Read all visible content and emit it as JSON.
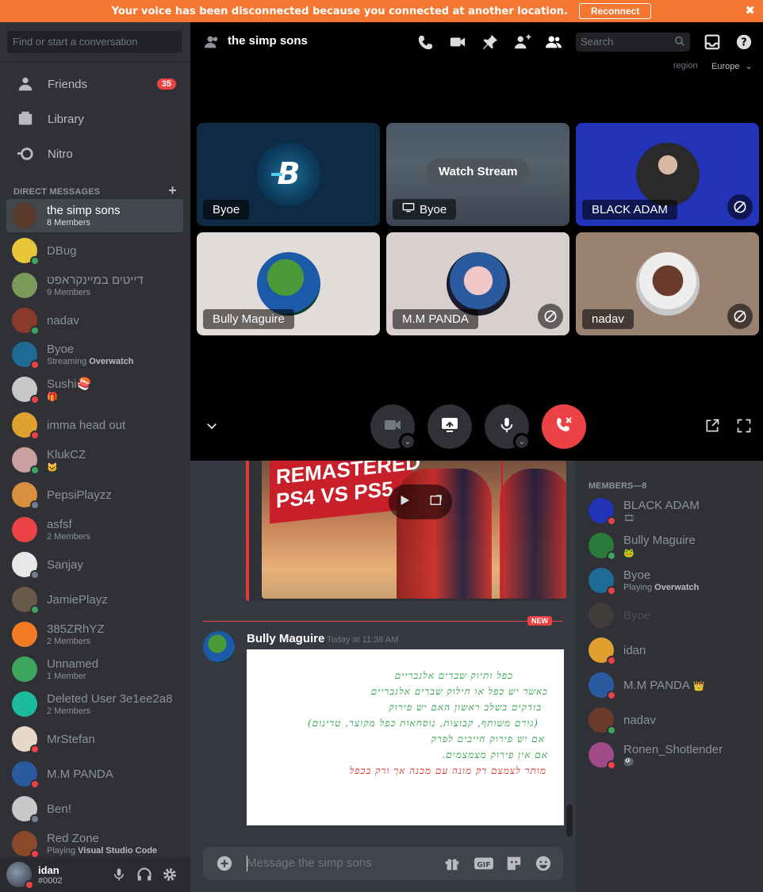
{
  "banner": {
    "message": "Your voice has been disconnected because you connected at another location.",
    "reconnect_label": "Reconnect",
    "close_glyph": "✖",
    "color": "#f57731"
  },
  "sidebar": {
    "search_placeholder": "Find or start a conversation",
    "nav": [
      {
        "label": "Friends",
        "icon": "friends-icon",
        "badge": "35"
      },
      {
        "label": "Library",
        "icon": "library-icon"
      },
      {
        "label": "Nitro",
        "icon": "nitro-icon"
      }
    ],
    "dm_header": "DIRECT MESSAGES",
    "dm_add": "+",
    "dms": [
      {
        "name": "the simp sons",
        "sub": "8 Members",
        "active": true
      },
      {
        "name": "DBug",
        "status": "online"
      },
      {
        "name": "דייטים במיינקראפט",
        "sub": "9 Members"
      },
      {
        "name": "nadav",
        "status": "online"
      },
      {
        "name": "Byoe",
        "sub_pre": "Streaming ",
        "sub_bold": "Overwatch",
        "status": "dnd"
      },
      {
        "name": "Sushi🍣",
        "sub": "🎁",
        "status": "dnd"
      },
      {
        "name": "imma head out",
        "status": "dnd"
      },
      {
        "name": "KlukCZ",
        "sub": "🐱",
        "status": "online"
      },
      {
        "name": "PepsiPlayzz",
        "status": "offline"
      },
      {
        "name": "asfsf",
        "sub": "2 Members"
      },
      {
        "name": "Sanjay",
        "status": "offline"
      },
      {
        "name": "JamiePlayz",
        "status": "online"
      },
      {
        "name": "385ZRhYZ",
        "sub": "2 Members"
      },
      {
        "name": "Unnamed",
        "sub": "1 Member"
      },
      {
        "name": "Deleted User 3e1ee2a8",
        "sub": "2 Members"
      },
      {
        "name": "MrStefan",
        "status": "dnd"
      },
      {
        "name": "M.M PANDA",
        "status": "dnd"
      },
      {
        "name": "Ben!",
        "status": "offline"
      },
      {
        "name": "Red Zone",
        "sub_pre": "Playing ",
        "sub_bold": "Visual Studio Code",
        "status": "dnd"
      }
    ],
    "user": {
      "name": "idan",
      "tag": "#0002"
    }
  },
  "call": {
    "title": "the simp sons",
    "search_placeholder": "Search",
    "region_label": "region",
    "region_value": "Europe",
    "tiles": [
      {
        "name": "Byoe",
        "bg": "#0f2a45"
      },
      {
        "name": "Byoe",
        "bg": "#3a4a5a",
        "stream_label": "Watch Stream"
      },
      {
        "name": "BLACK ADAM",
        "bg": "#2333b8"
      },
      {
        "name": "Bully Maguire",
        "bg": "#e2dcd8"
      },
      {
        "name": "M.M PANDA",
        "bg": "#d8d0ce"
      },
      {
        "name": "nadav",
        "bg": "#9a8272"
      }
    ],
    "end_call_color": "#ed4245"
  },
  "chat": {
    "embed_title": "REMASTERED PS4 VS PS5",
    "new_label": "NEW",
    "author": "Bully Maguire",
    "timestamp": "Today at 11:38 AM",
    "note_lines": [
      {
        "text": "כפל ותיוק שברים אלגבריים",
        "color": "#2fa14a"
      },
      {
        "text": "כאשר יש כפל או חילוק שברים אלגבריים",
        "color": "#2fa14a"
      },
      {
        "text": "בודקים בשלב ראשון האם יש פירוק",
        "color": "#2fa14a"
      },
      {
        "text": "(גורם משותף, קבוצות, נוסחאות כפל מקוצר, טרינום)",
        "color": "#2fa14a"
      },
      {
        "text": "אם יש פירוק חייבים לפרק",
        "color": "#2fa14a"
      },
      {
        "text": "אם אין פירוק מצמצמים.",
        "color": "#2fa14a"
      },
      {
        "text": "מותר לצמצם רק מונה עם מכנה אך ורק בכפל",
        "color": "#e0302c"
      }
    ],
    "composer_placeholder": "Message the simp sons"
  },
  "members": {
    "header": "MEMBERS—8",
    "list": [
      {
        "name": "BLACK ADAM",
        "sub": "🎞",
        "status": "dnd"
      },
      {
        "name": "Bully Maguire",
        "sub": "🐸",
        "status": "online"
      },
      {
        "name": "Byoe",
        "sub_pre": "Playing ",
        "sub_bold": "Overwatch",
        "status": "dnd"
      },
      {
        "name": "Byoe",
        "faded": true
      },
      {
        "name": "idan",
        "status": "dnd"
      },
      {
        "name": "M.M PANDA",
        "crown": "👑",
        "status": "dnd"
      },
      {
        "name": "nadav",
        "status": "online"
      },
      {
        "name": "Ronen_Shotlender",
        "sub": "🎱",
        "status": "dnd"
      }
    ]
  }
}
